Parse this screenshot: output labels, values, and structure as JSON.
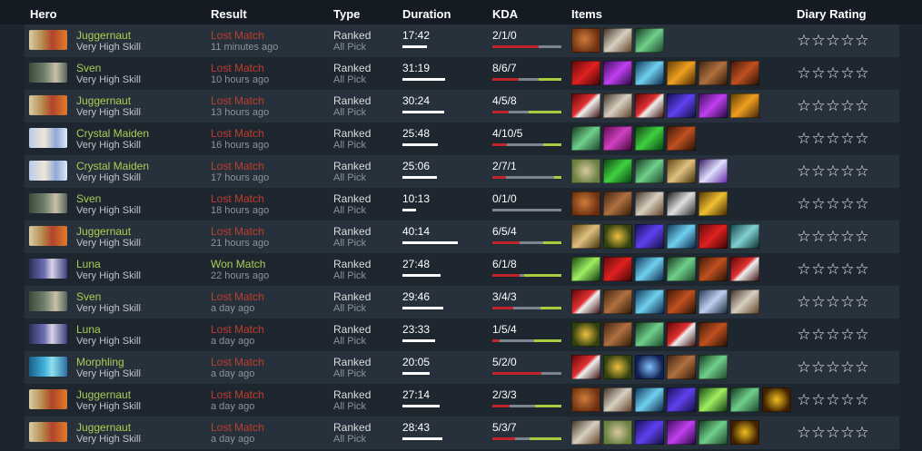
{
  "headers": {
    "hero": "Hero",
    "result": "Result",
    "type": "Type",
    "duration": "Duration",
    "kda": "KDA",
    "items": "Items",
    "rating": "Diary Rating"
  },
  "star_glyph": "☆",
  "matches": [
    {
      "hero": "Juggernaut",
      "skill": "Very High Skill",
      "result": "Lost Match",
      "outcome": "lost",
      "ago": "11 minutes ago",
      "type": "Ranked",
      "mode": "All Pick",
      "duration": "17:42",
      "kda": "2/1/0",
      "kills": 2,
      "deaths": 1,
      "assists": 0,
      "items": [
        "quelling-blade",
        "battle-fury",
        "blade-of-alacrity"
      ]
    },
    {
      "hero": "Sven",
      "skill": "Very High Skill",
      "result": "Lost Match",
      "outcome": "lost",
      "ago": "10 hours ago",
      "type": "Ranked",
      "mode": "All Pick",
      "duration": "31:19",
      "kda": "8/6/7",
      "kills": 8,
      "deaths": 6,
      "assists": 7,
      "items": [
        "armlet",
        "diffusal",
        "skadi",
        "mask-of-madness",
        "power-treads",
        "blade-mail"
      ]
    },
    {
      "hero": "Juggernaut",
      "skill": "Very High Skill",
      "result": "Lost Match",
      "outcome": "lost",
      "ago": "13 hours ago",
      "type": "Ranked",
      "mode": "All Pick",
      "duration": "30:24",
      "kda": "4/5/8",
      "kills": 4,
      "deaths": 5,
      "assists": 8,
      "items": [
        "sange-and-yasha",
        "battle-fury",
        "sange-and-yasha",
        "manta",
        "diffusal",
        "mask-of-madness"
      ]
    },
    {
      "hero": "Crystal Maiden",
      "skill": "Very High Skill",
      "result": "Lost Match",
      "outcome": "lost",
      "ago": "16 hours ago",
      "type": "Ranked",
      "mode": "All Pick",
      "duration": "25:48",
      "kda": "4/10/5",
      "kills": 4,
      "deaths": 10,
      "assists": 5,
      "items": [
        "blade-of-alacrity",
        "mantle",
        "boots-of-speed",
        "blade-mail"
      ]
    },
    {
      "hero": "Crystal Maiden",
      "skill": "Very High Skill",
      "result": "Lost Match",
      "outcome": "lost",
      "ago": "17 hours ago",
      "type": "Ranked",
      "mode": "All Pick",
      "duration": "25:06",
      "kda": "2/7/1",
      "kills": 2,
      "deaths": 7,
      "assists": 1,
      "items": [
        "bracer",
        "boots-of-speed",
        "blade-of-alacrity",
        "scroll",
        "dagon"
      ]
    },
    {
      "hero": "Sven",
      "skill": "Very High Skill",
      "result": "Lost Match",
      "outcome": "lost",
      "ago": "18 hours ago",
      "type": "Ranked",
      "mode": "All Pick",
      "duration": "10:13",
      "kda": "0/1/0",
      "kills": 0,
      "deaths": 1,
      "assists": 0,
      "items": [
        "quelling-blade",
        "power-treads",
        "battle-fury",
        "sickle",
        "gauntlets"
      ]
    },
    {
      "hero": "Juggernaut",
      "skill": "Very High Skill",
      "result": "Lost Match",
      "outcome": "lost",
      "ago": "21 hours ago",
      "type": "Ranked",
      "mode": "All Pick",
      "duration": "40:14",
      "kda": "6/5/4",
      "kills": 6,
      "deaths": 5,
      "assists": 4,
      "items": [
        "scroll",
        "ring",
        "manta",
        "skadi",
        "armlet",
        "satanic"
      ]
    },
    {
      "hero": "Luna",
      "skill": "Very High Skill",
      "result": "Won Match",
      "outcome": "won",
      "ago": "22 hours ago",
      "type": "Ranked",
      "mode": "All Pick",
      "duration": "27:48",
      "kda": "6/1/8",
      "kills": 6,
      "deaths": 1,
      "assists": 8,
      "items": [
        "butterfly",
        "armlet",
        "skadi",
        "blade-of-alacrity",
        "blade-mail",
        "sange-and-yasha"
      ]
    },
    {
      "hero": "Sven",
      "skill": "Very High Skill",
      "result": "Lost Match",
      "outcome": "lost",
      "ago": "a day ago",
      "type": "Ranked",
      "mode": "All Pick",
      "duration": "29:46",
      "kda": "3/4/3",
      "kills": 3,
      "deaths": 4,
      "assists": 3,
      "items": [
        "sange-and-yasha",
        "power-treads",
        "skadi",
        "blade-mail",
        "basher",
        "battle-fury"
      ]
    },
    {
      "hero": "Luna",
      "skill": "Very High Skill",
      "result": "Lost Match",
      "outcome": "lost",
      "ago": "a day ago",
      "type": "Ranked",
      "mode": "All Pick",
      "duration": "23:33",
      "kda": "1/5/4",
      "kills": 1,
      "deaths": 5,
      "assists": 4,
      "items": [
        "ring",
        "power-treads",
        "blade-of-alacrity",
        "sange-and-yasha",
        "blade-mail"
      ]
    },
    {
      "hero": "Morphling",
      "skill": "Very High Skill",
      "result": "Lost Match",
      "outcome": "lost",
      "ago": "a day ago",
      "type": "Ranked",
      "mode": "All Pick",
      "duration": "20:05",
      "kda": "5/2/0",
      "kills": 5,
      "deaths": 2,
      "assists": 0,
      "items": [
        "sange-and-yasha",
        "ring",
        "linkens",
        "power-treads",
        "blade-of-alacrity"
      ]
    },
    {
      "hero": "Juggernaut",
      "skill": "Very High Skill",
      "result": "Lost Match",
      "outcome": "lost",
      "ago": "a day ago",
      "type": "Ranked",
      "mode": "All Pick",
      "duration": "27:14",
      "kda": "2/3/3",
      "kills": 2,
      "deaths": 3,
      "assists": 3,
      "items": [
        "quelling-blade",
        "battle-fury",
        "skadi",
        "manta",
        "butterfly",
        "blade-of-alacrity",
        "mjollnir"
      ]
    },
    {
      "hero": "Juggernaut",
      "skill": "Very High Skill",
      "result": "Lost Match",
      "outcome": "lost",
      "ago": "a day ago",
      "type": "Ranked",
      "mode": "All Pick",
      "duration": "28:43",
      "kda": "5/3/7",
      "kills": 5,
      "deaths": 3,
      "assists": 7,
      "items": [
        "battle-fury",
        "bracer",
        "manta",
        "diffusal",
        "blade-of-alacrity",
        "mjollnir"
      ]
    }
  ]
}
